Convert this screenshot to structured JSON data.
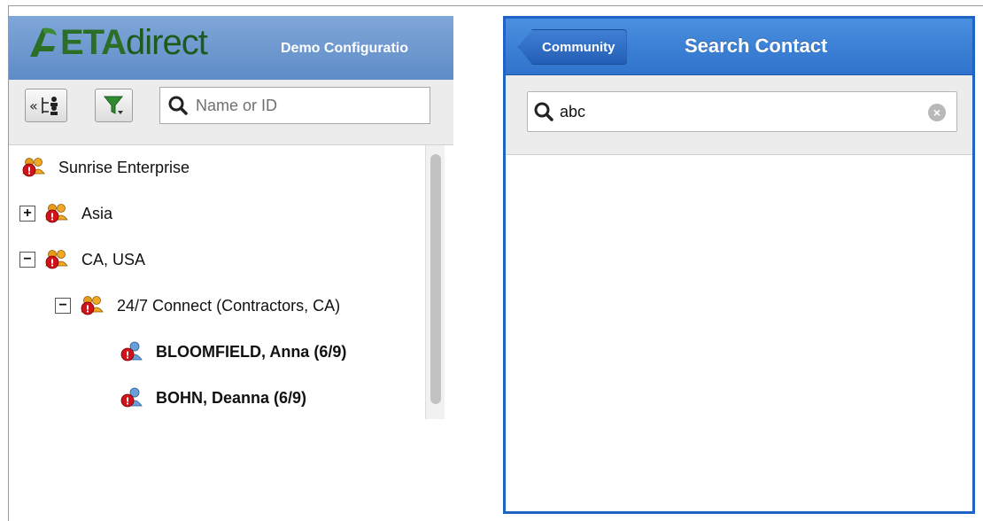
{
  "colors": {
    "header_blue": "#5f8cc8",
    "logo_green": "#2b6e26",
    "phone_blue": "#2f73cc",
    "alert_red": "#d0121b",
    "group_orange": "#e89a1a"
  },
  "app": {
    "logo_eta": "ETA",
    "logo_direct": "direct",
    "configuration_label": "Demo Configuratio"
  },
  "toolbar": {
    "collapse_icon": "collapse-tree-icon",
    "filter_icon": "filter-icon",
    "search_placeholder": "Name or ID",
    "search_value": ""
  },
  "tree": {
    "items": [
      {
        "label": "Sunrise Enterprise",
        "type": "group",
        "toggle": ""
      },
      {
        "label": "Asia",
        "type": "group",
        "toggle": "+"
      },
      {
        "label": "CA, USA",
        "type": "group",
        "toggle": "−"
      },
      {
        "label": "24/7 Connect (Contractors, CA)",
        "type": "group",
        "toggle": "−"
      },
      {
        "label": "BLOOMFIELD, Anna (6/9)",
        "type": "user",
        "toggle": ""
      },
      {
        "label": "BOHN, Deanna (6/9)",
        "type": "user",
        "toggle": ""
      }
    ]
  },
  "phone": {
    "back_label": "Community",
    "title": "Search Contact",
    "search_value": "abc",
    "clear_icon": "clear-icon"
  }
}
